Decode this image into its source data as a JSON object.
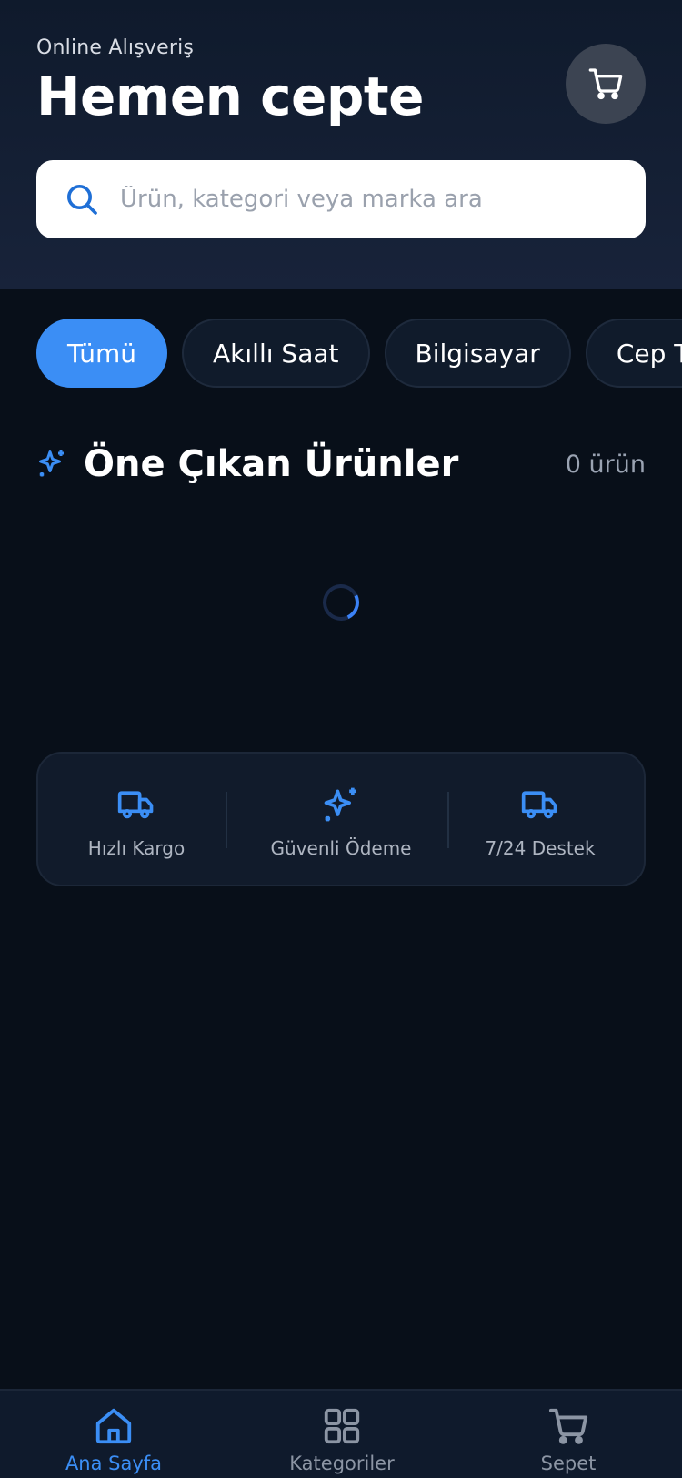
{
  "header": {
    "subtitle": "Online Alışveriş",
    "title": "Hemen cepte",
    "cart_icon": "cart-icon"
  },
  "search": {
    "icon": "search-icon",
    "placeholder": "Ürün, kategori veya marka ara",
    "value": ""
  },
  "categories": [
    {
      "label": "Tümü",
      "active": true
    },
    {
      "label": "Akıllı Saat",
      "active": false
    },
    {
      "label": "Bilgisayar",
      "active": false
    },
    {
      "label": "Cep Telefonu",
      "active": false
    }
  ],
  "featured": {
    "icon": "sparkles-icon",
    "title": "Öne Çıkan Ürünler",
    "count": "0 ürün",
    "loading": true
  },
  "features": [
    {
      "icon": "truck-icon",
      "label": "Hızlı Kargo"
    },
    {
      "icon": "sparkles-icon",
      "label": "Güvenli Ödeme"
    },
    {
      "icon": "truck-icon",
      "label": "7/24 Destek"
    }
  ],
  "nav": [
    {
      "icon": "home-icon",
      "label": "Ana Sayfa",
      "active": true
    },
    {
      "icon": "grid-icon",
      "label": "Kategoriler",
      "active": false
    },
    {
      "icon": "cart-icon",
      "label": "Sepet",
      "active": false
    }
  ],
  "colors": {
    "accent": "#3b8ef5",
    "background": "#080f19",
    "header": "#18233a",
    "card": "#111b2b"
  }
}
